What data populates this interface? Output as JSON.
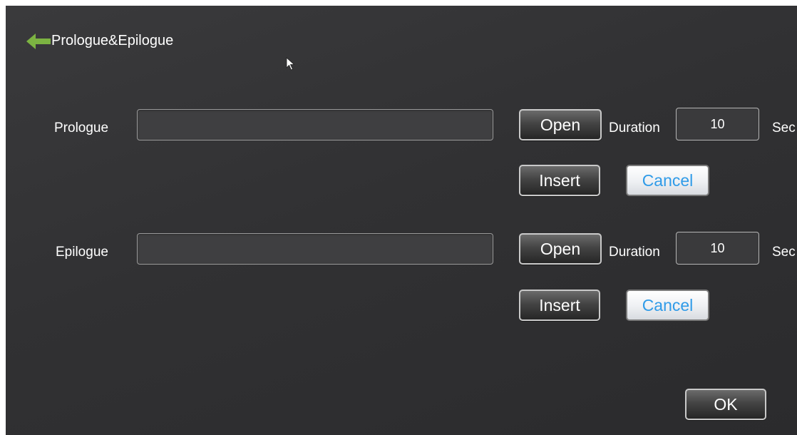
{
  "header": {
    "title": "Prologue&Epilogue",
    "back_icon": "back-arrow-icon",
    "back_icon_color": "#7cb342"
  },
  "prologue": {
    "label": "Prologue",
    "path_value": "",
    "open_label": "Open",
    "duration_label": "Duration",
    "duration_value": "10",
    "unit_label": "Sec",
    "insert_label": "Insert",
    "cancel_label": "Cancel"
  },
  "epilogue": {
    "label": "Epilogue",
    "path_value": "",
    "open_label": "Open",
    "duration_label": "Duration",
    "duration_value": "10",
    "unit_label": "Sec",
    "insert_label": "Insert",
    "cancel_label": "Cancel"
  },
  "footer": {
    "ok_label": "OK"
  },
  "colors": {
    "background": "#323234",
    "accent_text": "#2f9be8",
    "text": "#ffffff"
  }
}
